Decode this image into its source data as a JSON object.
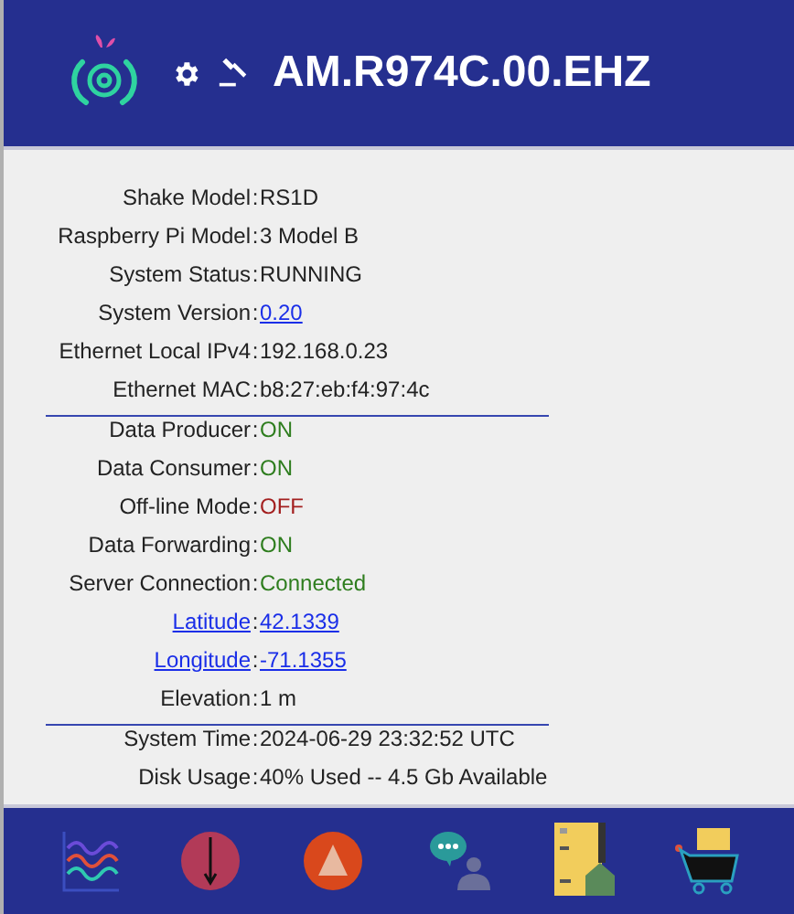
{
  "header": {
    "title": "AM.R974C.00.EHZ"
  },
  "sections": [
    {
      "rows": [
        {
          "label": "Shake Model",
          "label_link": false,
          "separator": ":",
          "value": "RS1D",
          "kind": "text"
        },
        {
          "label": "Raspberry Pi Model",
          "label_link": false,
          "separator": ":",
          "value": "3 Model B",
          "kind": "text"
        },
        {
          "label": "System Status",
          "label_link": false,
          "separator": ":",
          "value": "RUNNING",
          "kind": "text"
        },
        {
          "label": "System Version",
          "label_link": false,
          "separator": ":",
          "value": "0.20",
          "kind": "link"
        },
        {
          "label": "Ethernet Local IPv4",
          "label_link": false,
          "separator": ":",
          "value": "192.168.0.23",
          "kind": "text"
        },
        {
          "label": "Ethernet MAC",
          "label_link": false,
          "separator": ":",
          "value": "b8:27:eb:f4:97:4c",
          "kind": "text"
        }
      ]
    },
    {
      "rows": [
        {
          "label": "Data Producer",
          "label_link": false,
          "separator": ":",
          "value": "ON",
          "kind": "status",
          "color": "#2e7d1e"
        },
        {
          "label": "Data Consumer",
          "label_link": false,
          "separator": ":",
          "value": "ON",
          "kind": "status",
          "color": "#2e7d1e"
        },
        {
          "label": "Off-line Mode",
          "label_link": false,
          "separator": ":",
          "value": "OFF",
          "kind": "status",
          "color": "#a31f1f"
        },
        {
          "label": "Data Forwarding",
          "label_link": false,
          "separator": ":",
          "value": "ON",
          "kind": "status",
          "color": "#2e7d1e"
        },
        {
          "label": "Server Connection",
          "label_link": false,
          "separator": ":",
          "value": "Connected",
          "kind": "status",
          "color": "#2e7d1e"
        },
        {
          "label": "Latitude",
          "label_link": true,
          "separator": ":",
          "value": "42.1339",
          "kind": "link"
        },
        {
          "label": "Longitude",
          "label_link": true,
          "separator": ":",
          "value": "-71.1355",
          "kind": "link"
        },
        {
          "label": "Elevation",
          "label_link": false,
          "separator": ":",
          "value": "1 m",
          "kind": "text"
        }
      ]
    },
    {
      "rows": [
        {
          "label": "System Time",
          "label_link": false,
          "separator": ":",
          "value": "2024-06-29 23:32:52 UTC",
          "kind": "text"
        },
        {
          "label": "Disk Usage",
          "label_link": false,
          "separator": ":",
          "value": "40% Used -- 4.5 Gb Available",
          "kind": "text"
        }
      ]
    }
  ]
}
